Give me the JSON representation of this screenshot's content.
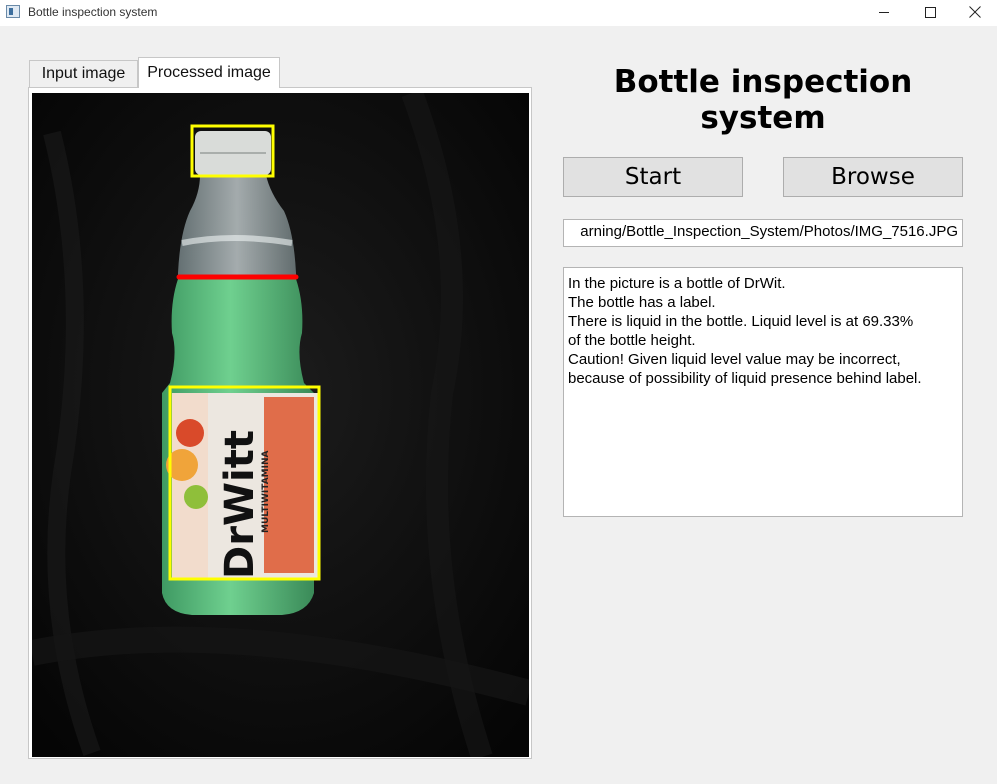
{
  "window": {
    "title": "Bottle inspection system",
    "icons": {
      "app": "app-window-icon",
      "minimize": "minimize-icon",
      "maximize": "maximize-icon",
      "close": "close-icon"
    }
  },
  "tabs": [
    {
      "label": "Input image",
      "active": false
    },
    {
      "label": "Processed image",
      "active": true
    }
  ],
  "image": {
    "overlay_colors": {
      "cap_box": "#ffff00",
      "label_box": "#ffff00",
      "liquid_level_line": "#ff0000"
    },
    "label_text": "DrWitt",
    "label_side_text": "MULTIWITAMINA"
  },
  "header": {
    "title": "Bottle inspection system"
  },
  "controls": {
    "start_label": "Start",
    "browse_label": "Browse",
    "path_value": "arning/Bottle_Inspection_System/Photos/IMG_7516.JPG"
  },
  "result": {
    "lines": [
      "In the picture is a bottle of DrWit.",
      "The bottle has a label.",
      "There is liquid in the bottle. Liquid level is at 69.33%",
      "of the bottle height.",
      "Caution! Given liquid level value may be incorrect,",
      "because of possibility of liquid presence behind label."
    ]
  }
}
